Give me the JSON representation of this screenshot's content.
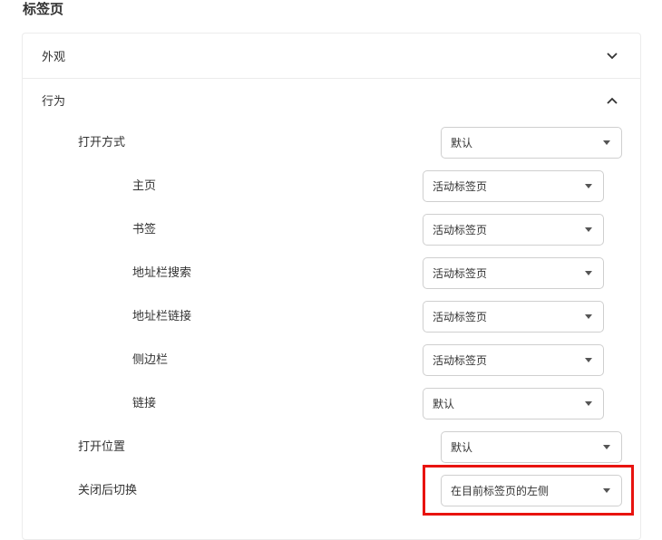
{
  "page": {
    "title": "标签页"
  },
  "sections": {
    "appearance": {
      "label": "外观",
      "icon": "chevron-down-icon"
    },
    "behavior": {
      "label": "行为",
      "icon": "chevron-up-icon"
    }
  },
  "behavior": {
    "open_method": {
      "label": "打开方式",
      "value": "默认"
    },
    "homepage": {
      "label": "主页",
      "value": "活动标签页"
    },
    "bookmarks": {
      "label": "书签",
      "value": "活动标签页"
    },
    "addressbar_search": {
      "label": "地址栏搜索",
      "value": "活动标签页"
    },
    "addressbar_link": {
      "label": "地址栏链接",
      "value": "活动标签页"
    },
    "sidebar": {
      "label": "侧边栏",
      "value": "活动标签页"
    },
    "link": {
      "label": "链接",
      "value": "默认"
    },
    "open_position": {
      "label": "打开位置",
      "value": "默认"
    },
    "switch_after_close": {
      "label": "关闭后切换",
      "value": "在目前标签页的左侧"
    }
  },
  "colors": {
    "highlight": "#e8130f",
    "border": "#cfcfcf"
  }
}
